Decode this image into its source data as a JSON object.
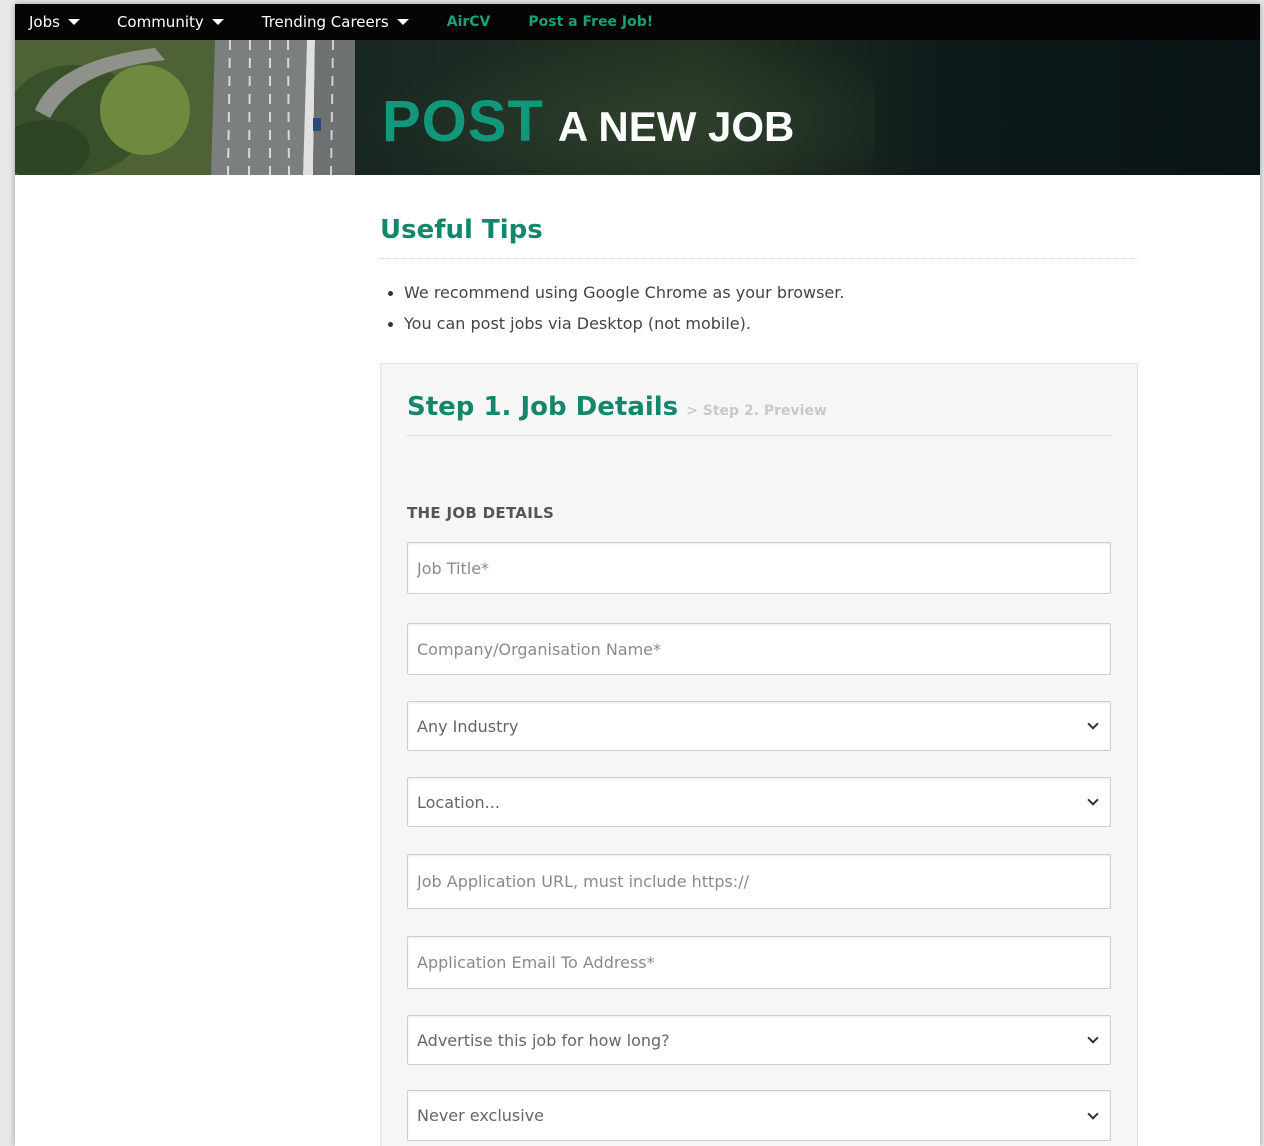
{
  "nav": {
    "items": [
      {
        "label": "Jobs",
        "dropdown": true
      },
      {
        "label": "Community",
        "dropdown": true
      },
      {
        "label": "Trending Careers",
        "dropdown": true
      },
      {
        "label": "AirCV",
        "dropdown": false
      },
      {
        "label": "Post a Free Job!",
        "dropdown": false
      }
    ]
  },
  "hero": {
    "title_big": "POST",
    "title_small": "A NEW JOB"
  },
  "tips": {
    "title": "Useful Tips",
    "items": [
      "We recommend using Google Chrome as your browser.",
      "You can post jobs via Desktop (not mobile)."
    ]
  },
  "form": {
    "step_active": "Step 1. Job Details",
    "step_next": "> Step 2. Preview",
    "section_label": "THE JOB DETAILS",
    "fields": {
      "job_title": {
        "placeholder": "Job Title*"
      },
      "company": {
        "placeholder": "Company/Organisation Name*"
      },
      "industry": {
        "selected": "Any Industry"
      },
      "location": {
        "selected": "Location..."
      },
      "app_url": {
        "placeholder": "Job Application URL, must include https://"
      },
      "app_email": {
        "placeholder": "Application Email To Address*"
      },
      "duration": {
        "selected": "Advertise this job for how long?"
      },
      "exclusive": {
        "selected": "Never exclusive"
      }
    }
  },
  "colors": {
    "accent": "#12876c",
    "nav_bg": "#050505",
    "link_green": "#17a07c"
  },
  "icons": {
    "caret": "caret-down-icon",
    "chevron": "chevron-down-icon"
  }
}
